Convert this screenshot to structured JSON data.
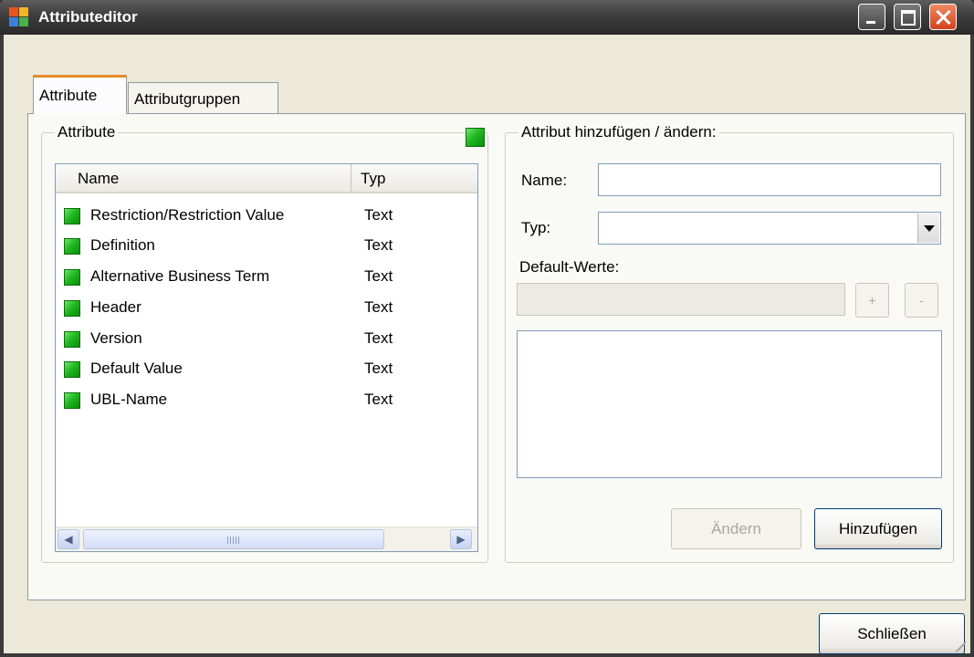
{
  "window": {
    "title": "Attributeditor",
    "controls": {
      "minimize": "minimize-icon",
      "maximize": "maximize-icon",
      "close": "close-icon"
    }
  },
  "tabs": [
    {
      "label": "Attribute",
      "active": true
    },
    {
      "label": "Attributgruppen",
      "active": false
    }
  ],
  "attribute_group": {
    "legend": "Attribute",
    "list": {
      "columns": [
        "Name",
        "Typ"
      ],
      "rows": [
        {
          "name": "Restriction/Restriction Value",
          "type": "Text"
        },
        {
          "name": "Definition",
          "type": "Text"
        },
        {
          "name": "Alternative Business Term",
          "type": "Text"
        },
        {
          "name": "Header",
          "type": "Text"
        },
        {
          "name": "Version",
          "type": "Text"
        },
        {
          "name": "Default Value",
          "type": "Text"
        },
        {
          "name": "UBL-Name",
          "type": "Text"
        }
      ]
    }
  },
  "edit_group": {
    "legend": "Attribut hinzufügen / ändern:",
    "name_label": "Name:",
    "name_value": "",
    "type_label": "Typ:",
    "type_value": "",
    "default_label": "Default-Werte:",
    "default_value": "",
    "plus_label": "+",
    "minus_label": "-",
    "aendern_label": "Ändern",
    "add_label": "Hinzufügen"
  },
  "footer": {
    "close_label": "Schließen"
  },
  "colors": {
    "attribute_icon": "#22b822",
    "title_bar": "#3d3d3d",
    "active_tab_accent": "#e68b2c"
  }
}
